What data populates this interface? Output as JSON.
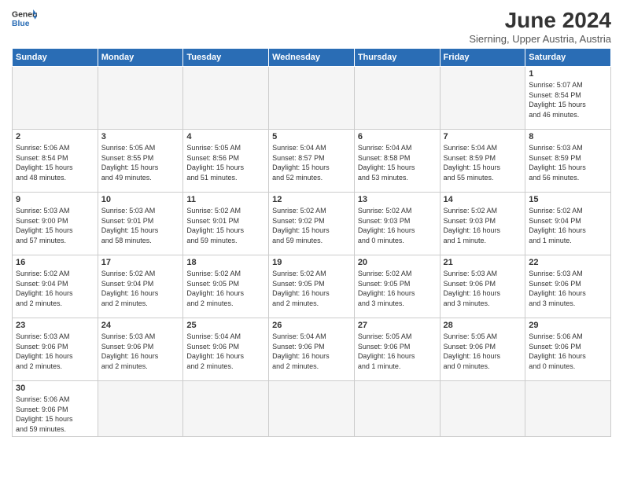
{
  "header": {
    "logo_general": "General",
    "logo_blue": "Blue",
    "month_title": "June 2024",
    "subtitle": "Sierning, Upper Austria, Austria"
  },
  "days_of_week": [
    "Sunday",
    "Monday",
    "Tuesday",
    "Wednesday",
    "Thursday",
    "Friday",
    "Saturday"
  ],
  "weeks": [
    [
      {
        "day": "",
        "info": "",
        "empty": true
      },
      {
        "day": "",
        "info": "",
        "empty": true
      },
      {
        "day": "",
        "info": "",
        "empty": true
      },
      {
        "day": "",
        "info": "",
        "empty": true
      },
      {
        "day": "",
        "info": "",
        "empty": true
      },
      {
        "day": "",
        "info": "",
        "empty": true
      },
      {
        "day": "1",
        "info": "Sunrise: 5:07 AM\nSunset: 8:54 PM\nDaylight: 15 hours\nand 46 minutes."
      }
    ],
    [
      {
        "day": "2",
        "info": "Sunrise: 5:06 AM\nSunset: 8:54 PM\nDaylight: 15 hours\nand 48 minutes."
      },
      {
        "day": "3",
        "info": "Sunrise: 5:05 AM\nSunset: 8:55 PM\nDaylight: 15 hours\nand 49 minutes."
      },
      {
        "day": "4",
        "info": "Sunrise: 5:05 AM\nSunset: 8:56 PM\nDaylight: 15 hours\nand 51 minutes."
      },
      {
        "day": "5",
        "info": "Sunrise: 5:04 AM\nSunset: 8:57 PM\nDaylight: 15 hours\nand 52 minutes."
      },
      {
        "day": "6",
        "info": "Sunrise: 5:04 AM\nSunset: 8:58 PM\nDaylight: 15 hours\nand 53 minutes."
      },
      {
        "day": "7",
        "info": "Sunrise: 5:04 AM\nSunset: 8:59 PM\nDaylight: 15 hours\nand 55 minutes."
      },
      {
        "day": "8",
        "info": "Sunrise: 5:03 AM\nSunset: 8:59 PM\nDaylight: 15 hours\nand 56 minutes."
      }
    ],
    [
      {
        "day": "9",
        "info": "Sunrise: 5:03 AM\nSunset: 9:00 PM\nDaylight: 15 hours\nand 57 minutes."
      },
      {
        "day": "10",
        "info": "Sunrise: 5:03 AM\nSunset: 9:01 PM\nDaylight: 15 hours\nand 58 minutes."
      },
      {
        "day": "11",
        "info": "Sunrise: 5:02 AM\nSunset: 9:01 PM\nDaylight: 15 hours\nand 59 minutes."
      },
      {
        "day": "12",
        "info": "Sunrise: 5:02 AM\nSunset: 9:02 PM\nDaylight: 15 hours\nand 59 minutes."
      },
      {
        "day": "13",
        "info": "Sunrise: 5:02 AM\nSunset: 9:03 PM\nDaylight: 16 hours\nand 0 minutes."
      },
      {
        "day": "14",
        "info": "Sunrise: 5:02 AM\nSunset: 9:03 PM\nDaylight: 16 hours\nand 1 minute."
      },
      {
        "day": "15",
        "info": "Sunrise: 5:02 AM\nSunset: 9:04 PM\nDaylight: 16 hours\nand 1 minute."
      }
    ],
    [
      {
        "day": "16",
        "info": "Sunrise: 5:02 AM\nSunset: 9:04 PM\nDaylight: 16 hours\nand 2 minutes."
      },
      {
        "day": "17",
        "info": "Sunrise: 5:02 AM\nSunset: 9:04 PM\nDaylight: 16 hours\nand 2 minutes."
      },
      {
        "day": "18",
        "info": "Sunrise: 5:02 AM\nSunset: 9:05 PM\nDaylight: 16 hours\nand 2 minutes."
      },
      {
        "day": "19",
        "info": "Sunrise: 5:02 AM\nSunset: 9:05 PM\nDaylight: 16 hours\nand 2 minutes."
      },
      {
        "day": "20",
        "info": "Sunrise: 5:02 AM\nSunset: 9:05 PM\nDaylight: 16 hours\nand 3 minutes."
      },
      {
        "day": "21",
        "info": "Sunrise: 5:03 AM\nSunset: 9:06 PM\nDaylight: 16 hours\nand 3 minutes."
      },
      {
        "day": "22",
        "info": "Sunrise: 5:03 AM\nSunset: 9:06 PM\nDaylight: 16 hours\nand 3 minutes."
      }
    ],
    [
      {
        "day": "23",
        "info": "Sunrise: 5:03 AM\nSunset: 9:06 PM\nDaylight: 16 hours\nand 2 minutes."
      },
      {
        "day": "24",
        "info": "Sunrise: 5:03 AM\nSunset: 9:06 PM\nDaylight: 16 hours\nand 2 minutes."
      },
      {
        "day": "25",
        "info": "Sunrise: 5:04 AM\nSunset: 9:06 PM\nDaylight: 16 hours\nand 2 minutes."
      },
      {
        "day": "26",
        "info": "Sunrise: 5:04 AM\nSunset: 9:06 PM\nDaylight: 16 hours\nand 2 minutes."
      },
      {
        "day": "27",
        "info": "Sunrise: 5:05 AM\nSunset: 9:06 PM\nDaylight: 16 hours\nand 1 minute."
      },
      {
        "day": "28",
        "info": "Sunrise: 5:05 AM\nSunset: 9:06 PM\nDaylight: 16 hours\nand 0 minutes."
      },
      {
        "day": "29",
        "info": "Sunrise: 5:06 AM\nSunset: 9:06 PM\nDaylight: 16 hours\nand 0 minutes."
      }
    ],
    [
      {
        "day": "30",
        "info": "Sunrise: 5:06 AM\nSunset: 9:06 PM\nDaylight: 15 hours\nand 59 minutes.",
        "last": true
      },
      {
        "day": "",
        "info": "",
        "empty": true,
        "last": true
      },
      {
        "day": "",
        "info": "",
        "empty": true,
        "last": true
      },
      {
        "day": "",
        "info": "",
        "empty": true,
        "last": true
      },
      {
        "day": "",
        "info": "",
        "empty": true,
        "last": true
      },
      {
        "day": "",
        "info": "",
        "empty": true,
        "last": true
      },
      {
        "day": "",
        "info": "",
        "empty": true,
        "last": true
      }
    ]
  ]
}
